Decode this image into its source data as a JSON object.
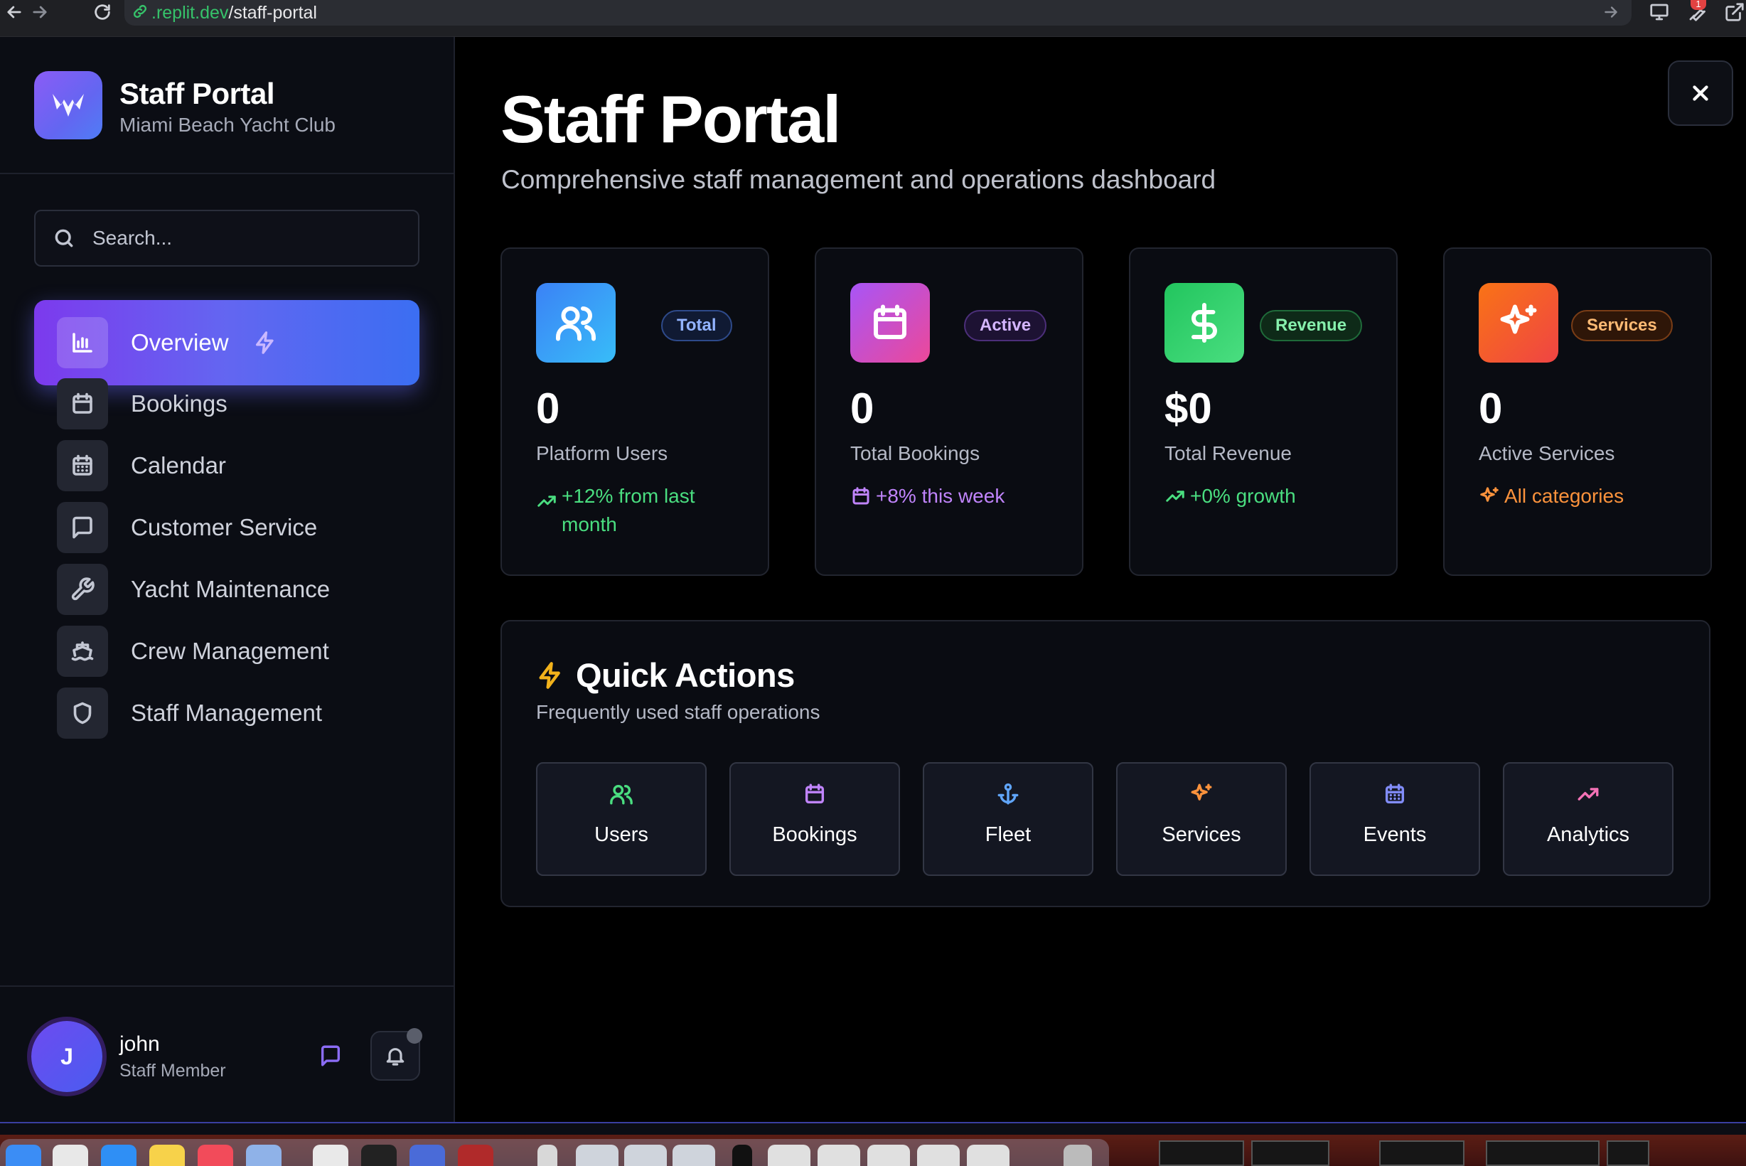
{
  "browser": {
    "url_host": ".replit.dev",
    "url_path": "/staff-portal",
    "notification_badge": "1"
  },
  "sidebar": {
    "brand_title": "Staff Portal",
    "brand_subtitle": "Miami Beach Yacht Club",
    "search_placeholder": "Search...",
    "items": [
      {
        "label": "Overview",
        "icon": "bar-chart-icon",
        "active": true
      },
      {
        "label": "Bookings",
        "icon": "calendar-icon",
        "active": false
      },
      {
        "label": "Calendar",
        "icon": "calendar-grid-icon",
        "active": false
      },
      {
        "label": "Customer Service",
        "icon": "message-square-icon",
        "active": false
      },
      {
        "label": "Yacht Maintenance",
        "icon": "wrench-icon",
        "active": false
      },
      {
        "label": "Crew Management",
        "icon": "ship-icon",
        "active": false
      },
      {
        "label": "Staff Management",
        "icon": "shield-icon",
        "active": false
      }
    ],
    "user": {
      "initial": "J",
      "name": "john",
      "role": "Staff Member"
    }
  },
  "main": {
    "title": "Staff Portal",
    "subtitle": "Comprehensive staff management and operations dashboard",
    "stats": [
      {
        "badge": "Total",
        "value": "0",
        "label": "Platform Users",
        "trend": "+12% from last month",
        "icon": "users-icon",
        "trend_icon": "trending-up-icon",
        "accent": "#4ade80",
        "badge_color": "#93b4ff"
      },
      {
        "badge": "Active",
        "value": "0",
        "label": "Total Bookings",
        "trend": "+8% this week",
        "icon": "calendar-icon",
        "trend_icon": "calendar-icon",
        "accent": "#c084fc",
        "badge_color": "#d4b6ff"
      },
      {
        "badge": "Revenue",
        "value": "$0",
        "label": "Total Revenue",
        "trend": "+0% growth",
        "icon": "dollar-icon",
        "trend_icon": "trending-up-icon",
        "accent": "#4ade80",
        "badge_color": "#86efac"
      },
      {
        "badge": "Services",
        "value": "0",
        "label": "Active Services",
        "trend": "All categories",
        "icon": "sparkles-icon",
        "trend_icon": "sparkles-icon",
        "accent": "#fb923c",
        "badge_color": "#fdba74"
      }
    ],
    "quick_actions": {
      "title": "Quick Actions",
      "subtitle": "Frequently used staff operations",
      "buttons": [
        {
          "label": "Users",
          "icon": "users-icon",
          "color": "#4ade80"
        },
        {
          "label": "Bookings",
          "icon": "calendar-icon",
          "color": "#c084fc"
        },
        {
          "label": "Fleet",
          "icon": "anchor-icon",
          "color": "#60a5fa"
        },
        {
          "label": "Services",
          "icon": "sparkles-icon",
          "color": "#fb923c"
        },
        {
          "label": "Events",
          "icon": "calendar-grid-icon",
          "color": "#818cf8"
        },
        {
          "label": "Analytics",
          "icon": "trending-up-icon",
          "color": "#f472b6"
        }
      ]
    }
  },
  "colors": {
    "background": "#000000",
    "sidebar": "#0b0d14",
    "card": "#0a0c12",
    "accent_gradient_start": "#7c3aed",
    "accent_gradient_end": "#3b6ef2"
  }
}
